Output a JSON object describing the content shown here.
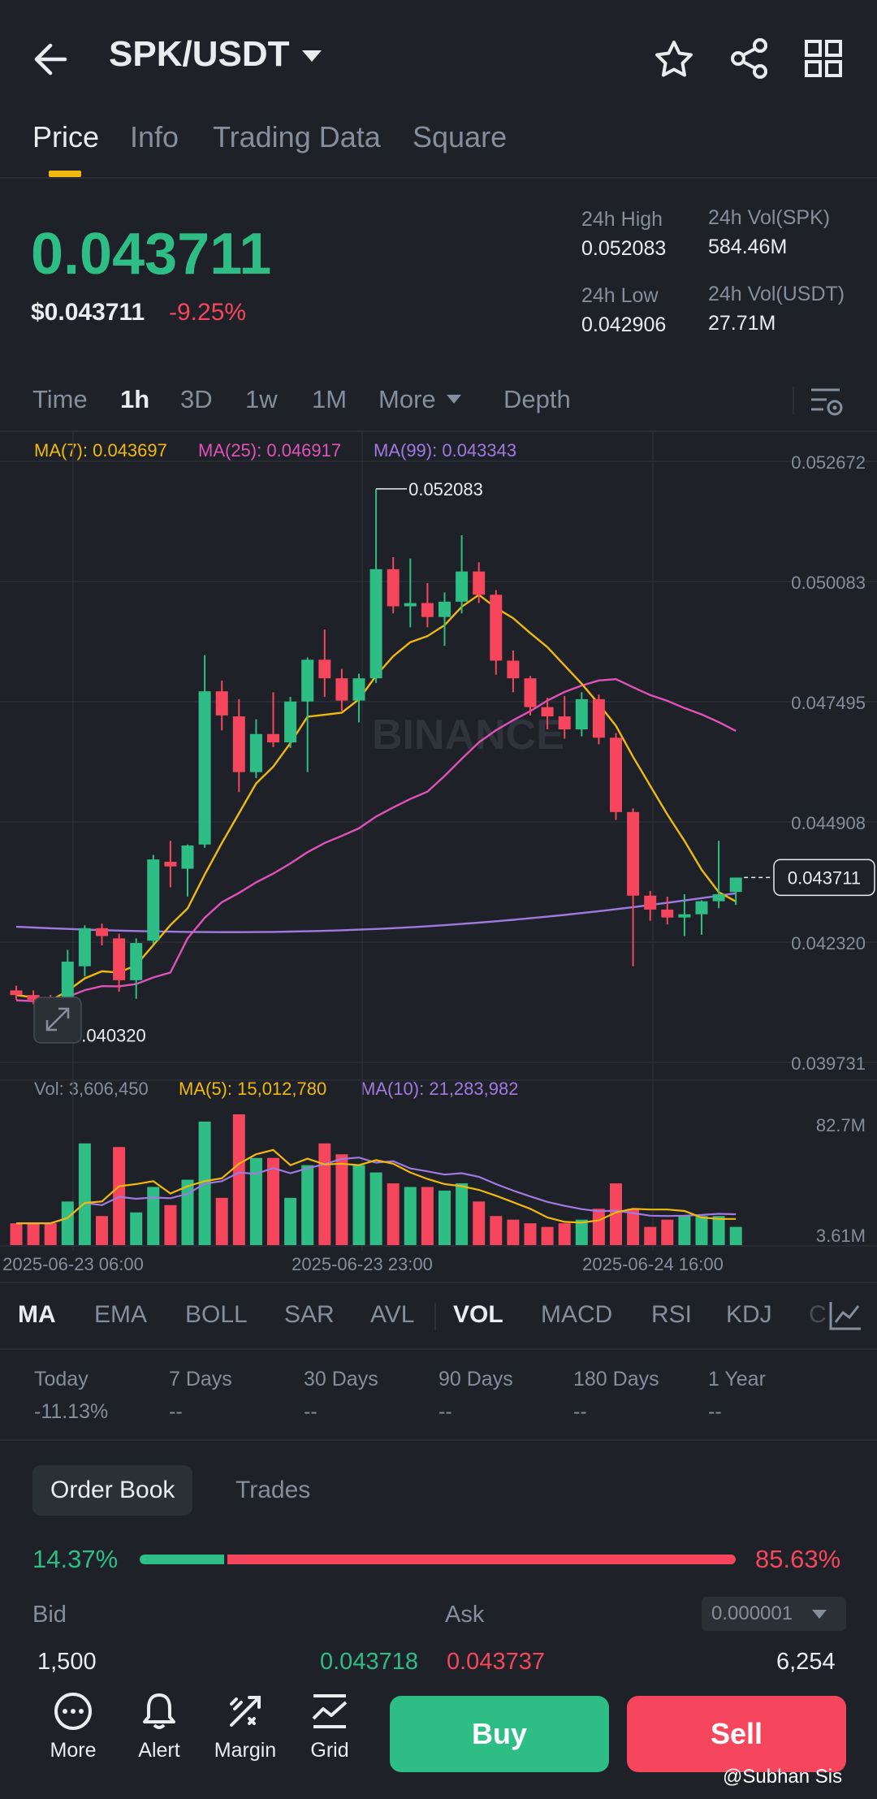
{
  "header": {
    "pair": "SPK/USDT",
    "icons": [
      "back-arrow-icon",
      "chevron-down-icon",
      "star-icon",
      "share-icon",
      "grid-icon"
    ]
  },
  "tabs": [
    {
      "label": "Price",
      "active": true
    },
    {
      "label": "Info",
      "active": false
    },
    {
      "label": "Trading Data",
      "active": false
    },
    {
      "label": "Square",
      "active": false
    }
  ],
  "ticker": {
    "price": "0.043711",
    "usd_price": "$0.043711",
    "change": "-9.25%",
    "high_label": "24h High",
    "high": "0.052083",
    "low_label": "24h Low",
    "low": "0.042906",
    "vol_base_label": "24h Vol(SPK)",
    "vol_base": "584.46M",
    "vol_quote_label": "24h Vol(USDT)",
    "vol_quote": "27.71M"
  },
  "timeframes": {
    "items": [
      "Time",
      "1h",
      "3D",
      "1w",
      "1M",
      "More",
      "Depth"
    ],
    "active": "1h"
  },
  "chart_legend": {
    "ma7": "MA(7): 0.043697",
    "ma25": "MA(25): 0.046917",
    "ma99": "MA(99): 0.043343",
    "vol": "Vol: 3,606,450",
    "vol_ma5": "MA(5): 15,012,780",
    "vol_ma10": "MA(10): 21,283,982",
    "watermark": "BINANCE"
  },
  "chart_data": {
    "type": "candlestick",
    "price_axis": [
      "0.052672",
      "0.050083",
      "0.047495",
      "0.044908",
      "0.042320",
      "0.039731"
    ],
    "ylim": [
      0.039731,
      0.052672
    ],
    "high_marker": "0.052083",
    "low_marker": "0.040320",
    "current_price_tag": "0.043711",
    "volume_axis": [
      "82.7M",
      "3.61M"
    ],
    "x_ticks": [
      "2025-06-23 06:00",
      "2025-06-23 23:00",
      "2025-06-24 16:00"
    ],
    "candles": [
      [
        0.04128,
        0.04138,
        0.04108,
        0.04118
      ],
      [
        0.04118,
        0.04128,
        0.04098,
        0.04108
      ],
      [
        0.04108,
        0.04118,
        0.04062,
        0.04092
      ],
      [
        0.04088,
        0.04215,
        0.04032,
        0.0419
      ],
      [
        0.0418,
        0.04268,
        0.04158,
        0.04262
      ],
      [
        0.04262,
        0.04272,
        0.04225,
        0.04245
      ],
      [
        0.0424,
        0.0425,
        0.04125,
        0.0415
      ],
      [
        0.0415,
        0.0424,
        0.0411,
        0.0423
      ],
      [
        0.04235,
        0.0442,
        0.04228,
        0.0441
      ],
      [
        0.04405,
        0.0445,
        0.0435,
        0.04395
      ],
      [
        0.0439,
        0.04442,
        0.0433,
        0.0444
      ],
      [
        0.04442,
        0.0485,
        0.04435,
        0.04772
      ],
      [
        0.04772,
        0.04795,
        0.04688,
        0.0472
      ],
      [
        0.04718,
        0.04755,
        0.04555,
        0.04598
      ],
      [
        0.04598,
        0.04712,
        0.04585,
        0.0468
      ],
      [
        0.0468,
        0.0477,
        0.04652,
        0.04662
      ],
      [
        0.04662,
        0.0476,
        0.0465,
        0.0475
      ],
      [
        0.0475,
        0.04845,
        0.04598,
        0.0484
      ],
      [
        0.0484,
        0.04905,
        0.0476,
        0.048
      ],
      [
        0.048,
        0.0482,
        0.0473,
        0.04752
      ],
      [
        0.04752,
        0.0481,
        0.04705,
        0.048
      ],
      [
        0.048,
        0.05208,
        0.0479,
        0.05035
      ],
      [
        0.05035,
        0.05061,
        0.0494,
        0.04955
      ],
      [
        0.04955,
        0.05058,
        0.0491,
        0.04962
      ],
      [
        0.04962,
        0.05005,
        0.0491,
        0.04932
      ],
      [
        0.04932,
        0.04985,
        0.0487,
        0.04965
      ],
      [
        0.04965,
        0.05108,
        0.0494,
        0.0503
      ],
      [
        0.0503,
        0.0505,
        0.04962,
        0.0498
      ],
      [
        0.0498,
        0.0499,
        0.04808,
        0.04838
      ],
      [
        0.04838,
        0.0486,
        0.0477,
        0.048
      ],
      [
        0.048,
        0.04805,
        0.0472,
        0.04738
      ],
      [
        0.04738,
        0.04758,
        0.0469,
        0.04718
      ],
      [
        0.04718,
        0.04762,
        0.0467,
        0.0469
      ],
      [
        0.0469,
        0.0477,
        0.04675,
        0.04755
      ],
      [
        0.04755,
        0.04765,
        0.04658,
        0.04672
      ],
      [
        0.04672,
        0.04682,
        0.04495,
        0.04512
      ],
      [
        0.04512,
        0.0452,
        0.0418,
        0.04332
      ],
      [
        0.04332,
        0.04342,
        0.04278,
        0.04302
      ],
      [
        0.04302,
        0.0433,
        0.0427,
        0.04285
      ],
      [
        0.04285,
        0.04335,
        0.04245,
        0.04292
      ],
      [
        0.04292,
        0.04322,
        0.04248,
        0.0432
      ],
      [
        0.0432,
        0.0445,
        0.04305,
        0.04335
      ],
      [
        0.0434,
        0.0436,
        0.04312,
        0.04371
      ]
    ],
    "volume_bars": [
      0.06,
      0.06,
      0.06,
      0.12,
      0.28,
      0.08,
      0.27,
      0.09,
      0.16,
      0.11,
      0.18,
      0.34,
      0.13,
      0.36,
      0.24,
      0.24,
      0.13,
      0.22,
      0.28,
      0.25,
      0.22,
      0.2,
      0.17,
      0.16,
      0.16,
      0.15,
      0.17,
      0.12,
      0.08,
      0.07,
      0.06,
      0.05,
      0.06,
      0.07,
      0.1,
      0.17,
      0.1,
      0.05,
      0.07,
      0.08,
      0.08,
      0.08,
      0.05
    ],
    "ma_lines": [
      "MA(7)",
      "MA(25)",
      "MA(99)"
    ]
  },
  "indicators": {
    "items": [
      "MA",
      "EMA",
      "BOLL",
      "SAR",
      "AVL",
      "VOL",
      "MACD",
      "RSI",
      "KDJ",
      "C"
    ],
    "active": [
      "MA",
      "VOL"
    ]
  },
  "periods": [
    {
      "label": "Today",
      "value": "-11.13%"
    },
    {
      "label": "7 Days",
      "value": "--"
    },
    {
      "label": "30 Days",
      "value": "--"
    },
    {
      "label": "90 Days",
      "value": "--"
    },
    {
      "label": "180 Days",
      "value": "--"
    },
    {
      "label": "1 Year",
      "value": "--"
    }
  ],
  "orderbook": {
    "tab_active": "Order Book",
    "tab_other": "Trades",
    "bid_pct": "14.37%",
    "ask_pct": "85.63%",
    "bid_label": "Bid",
    "ask_label": "Ask",
    "precision": "0.000001",
    "row": {
      "bid_qty": "1,500",
      "bid_price": "0.043718",
      "ask_price": "0.043737",
      "ask_qty": "6,254"
    }
  },
  "bottom_nav": {
    "items": [
      {
        "label": "More",
        "icon": "more-icon"
      },
      {
        "label": "Alert",
        "icon": "bell-icon"
      },
      {
        "label": "Margin",
        "icon": "margin-icon"
      },
      {
        "label": "Grid",
        "icon": "grid-trading-icon"
      }
    ],
    "buy": "Buy",
    "sell": "Sell"
  },
  "watermark_text": "@Subhan Sis"
}
